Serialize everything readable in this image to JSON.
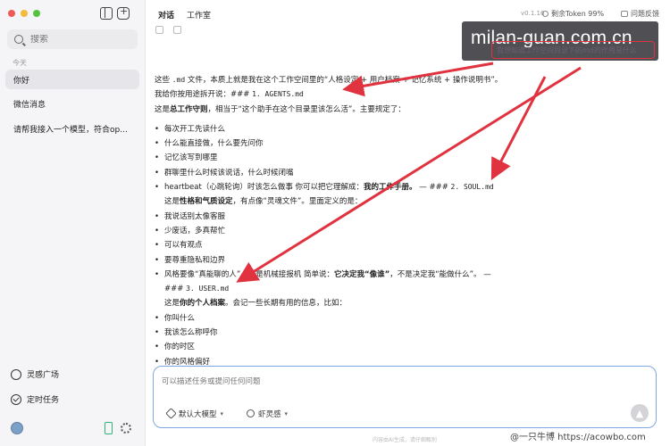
{
  "sidebar": {
    "search_placeholder": "搜索",
    "section_today": "今天",
    "items": [
      {
        "label": "你好"
      },
      {
        "label": "微信消息"
      },
      {
        "label": "请帮我接入一个模型，符合op..."
      }
    ],
    "bottom": {
      "plaza": "灵感广场",
      "scheduled": "定时任务"
    }
  },
  "topbar": {
    "tab_chat": "对话",
    "tab_workspace": "工作室",
    "version": "v0.1.16",
    "token": "剩余Token 99%",
    "feedback": "问题反馈"
  },
  "watermark": {
    "site": "milan-guan.com.cn",
    "highlight_text": "我想知道工作空间目录下的md的作用是什么"
  },
  "message": {
    "p1_a": "这些",
    "p1_code1": ".md",
    "p1_b": "文件，本质上就是我在这个工作空间里的“人格设定 + 用户档案 + 记忆系统 + 操作说明书”。我给你按用途拆开说：###",
    "p1_code2": "1. AGENTS.md",
    "p2_a": "这是",
    "p2_bold": "总工作守则",
    "p2_b": "，相当于“这个助手在这个目录里该怎么活”。主要规定了：",
    "list1": [
      "每次开工先读什么",
      "什么能直接做，什么要先问你",
      "记忆该写到哪里",
      "群聊里什么时候该说话，什么时候闭嘴"
    ],
    "hb_a": "heartbeat（心跳轮询）时该怎么做事 你可以把它理解成：",
    "hb_bold": "我的工作手册。",
    "hb_b": "— ###",
    "hb_code": "2. SOUL.md",
    "soul_a": "这是",
    "soul_bold": "性格和气质设定",
    "soul_b": "，有点像“灵魂文件”。里面定义的是：",
    "list2": [
      "我说话别太像客服",
      "少废话，多真帮忙",
      "可以有观点",
      "要尊重隐私和边界"
    ],
    "style_a": "风格要像“真能聊的人”，不是机械接报机 简单说：",
    "style_bold": "它决定我“像谁”",
    "style_b": "，不是决定我“能做什么”。 —",
    "style_c": "###",
    "style_code": "3. USER.md",
    "user_a": "这是",
    "user_bold": "你的个人档案",
    "user_b": "。会记一些长期有用的信息，比如：",
    "list3": [
      "你叫什么",
      "我该怎么称呼你",
      "你的时区",
      "你的风格偏好"
    ]
  },
  "composer": {
    "placeholder": "可以描述任务或提问任何问题",
    "model_chip": "默认大模型",
    "spirit_chip": "虾灵感",
    "footer": "内容由AI生成，请仔细甄别",
    "credit": "@一只牛博  https://acowbo.com"
  },
  "colors": {
    "accent_blue": "#7fa7e6",
    "annotation_red": "#e0323f"
  }
}
